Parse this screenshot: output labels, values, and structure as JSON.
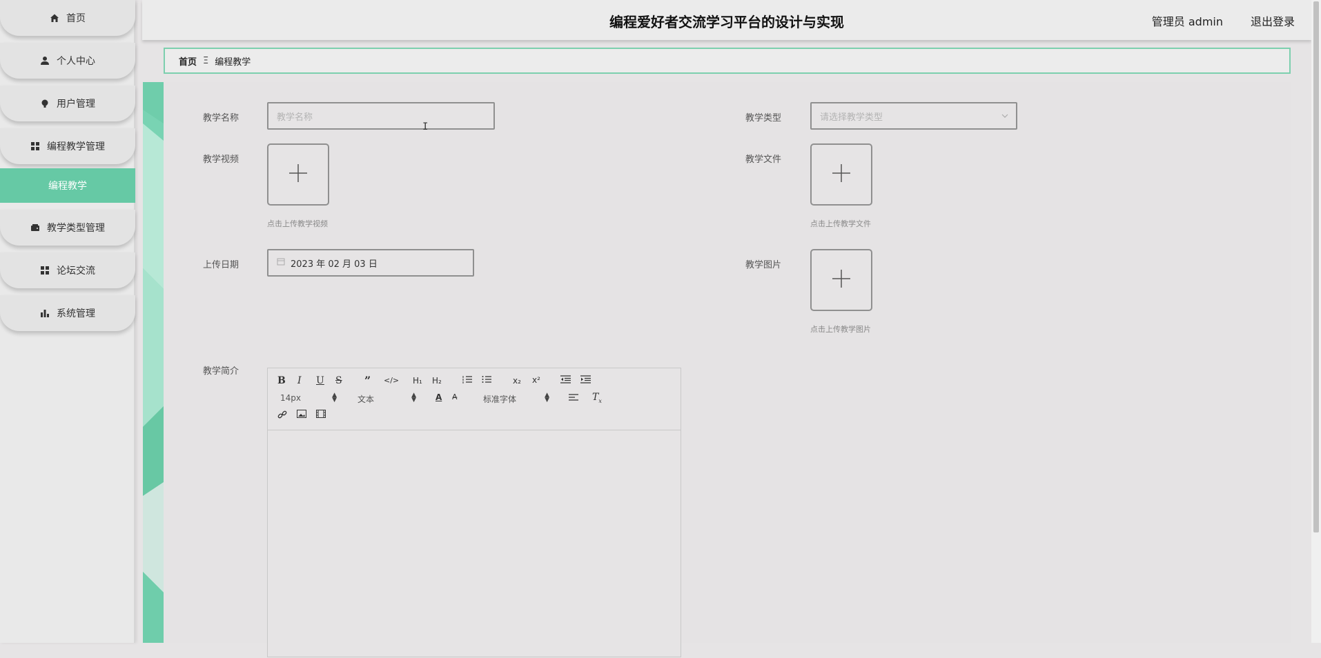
{
  "sidebar": {
    "items": [
      {
        "label": "首页",
        "icon": "home-icon"
      },
      {
        "label": "个人中心",
        "icon": "user-icon"
      },
      {
        "label": "用户管理",
        "icon": "bulb-icon"
      },
      {
        "label": "编程教学管理",
        "icon": "grid-icon"
      },
      {
        "label": "编程教学",
        "icon": "",
        "active": true
      },
      {
        "label": "教学类型管理",
        "icon": "wallet-icon"
      },
      {
        "label": "论坛交流",
        "icon": "grid-icon"
      },
      {
        "label": "系统管理",
        "icon": "bar-chart-icon"
      }
    ],
    "accent": "#66c9a5"
  },
  "header": {
    "title": "编程爱好者交流学习平台的设计与实现",
    "user": "管理员 admin",
    "logout": "退出登录"
  },
  "breadcrumb": {
    "home": "首页",
    "separator": "Ξ",
    "current": "编程教学"
  },
  "form": {
    "name_label": "教学名称",
    "name_placeholder": "教学名称",
    "type_label": "教学类型",
    "type_placeholder": "请选择教学类型",
    "video_label": "教学视频",
    "video_hint": "点击上传教学视频",
    "file_label": "教学文件",
    "file_hint": "点击上传教学文件",
    "date_label": "上传日期",
    "date_value": "2023 年 02 月 03 日",
    "image_label": "教学图片",
    "image_hint": "点击上传教学图片",
    "intro_label": "教学简介"
  },
  "editor": {
    "size": "14px",
    "format": "文本",
    "font": "标准字体"
  }
}
